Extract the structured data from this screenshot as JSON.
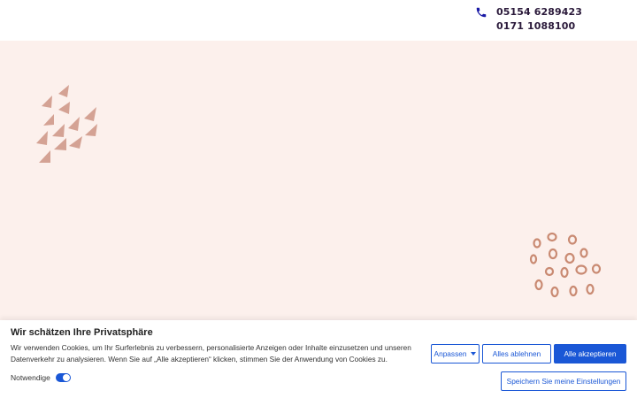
{
  "header": {
    "phone_icon": "phone-icon",
    "phone_numbers": [
      "05154 6289423",
      "0171 1088100"
    ]
  },
  "hero": {
    "background_color": "#fcf0ec",
    "decor_triangle_color": "#d4a294",
    "decor_circle_color": "#c98a72"
  },
  "cookie_banner": {
    "title": "Wir schätzen Ihre Privatsphäre",
    "text": "Wir verwenden Cookies, um Ihr Surferlebnis zu verbessern, personalisierte Anzeigen oder Inhalte einzusetzen und unseren Datenverkehr zu analysieren. Wenn Sie auf „Alle akzeptieren“ klicken, stimmen Sie der Anwendung von Cookies zu.",
    "necessary_label": "Notwendige",
    "customize_label": "Anpassen",
    "reject_label": "Alles ablehnen",
    "accept_label": "Alle akzeptieren",
    "save_label": "Speichern Sie meine Einstellungen",
    "accent_color": "#1a57d6"
  }
}
